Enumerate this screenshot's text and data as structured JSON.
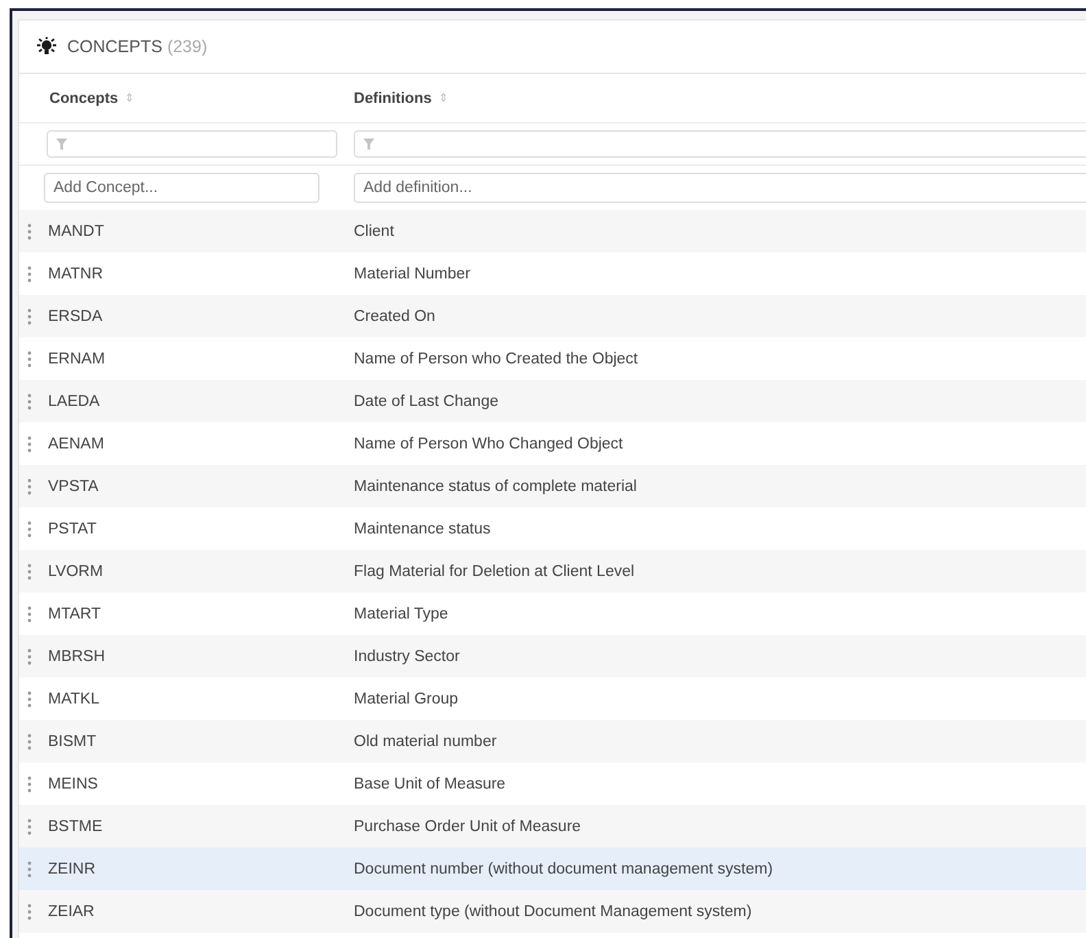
{
  "panel": {
    "title": "CONCEPTS",
    "count": "(239)"
  },
  "table": {
    "columns": [
      {
        "label": "Concepts",
        "sort_icon": "⇕"
      },
      {
        "label": "Definitions",
        "sort_icon": "⇕"
      }
    ],
    "add_row": [
      {
        "placeholder": "Add Concept..."
      },
      {
        "placeholder": "Add definition..."
      }
    ],
    "rows": [
      {
        "concept": "MANDT",
        "definition": "Client",
        "highlighted": false
      },
      {
        "concept": "MATNR",
        "definition": "Material Number",
        "highlighted": false
      },
      {
        "concept": "ERSDA",
        "definition": "Created On",
        "highlighted": false
      },
      {
        "concept": "ERNAM",
        "definition": "Name of Person who Created the Object",
        "highlighted": false
      },
      {
        "concept": "LAEDA",
        "definition": "Date of Last Change",
        "highlighted": false
      },
      {
        "concept": "AENAM",
        "definition": "Name of Person Who Changed Object",
        "highlighted": false
      },
      {
        "concept": "VPSTA",
        "definition": "Maintenance status of complete material",
        "highlighted": false
      },
      {
        "concept": "PSTAT",
        "definition": "Maintenance status",
        "highlighted": false
      },
      {
        "concept": "LVORM",
        "definition": "Flag Material for Deletion at Client Level",
        "highlighted": false
      },
      {
        "concept": "MTART",
        "definition": "Material Type",
        "highlighted": false
      },
      {
        "concept": "MBRSH",
        "definition": "Industry Sector",
        "highlighted": false
      },
      {
        "concept": "MATKL",
        "definition": "Material Group",
        "highlighted": false
      },
      {
        "concept": "BISMT",
        "definition": "Old material number",
        "highlighted": false
      },
      {
        "concept": "MEINS",
        "definition": "Base Unit of Measure",
        "highlighted": false
      },
      {
        "concept": "BSTME",
        "definition": "Purchase Order Unit of Measure",
        "highlighted": false
      },
      {
        "concept": "ZEINR",
        "definition": "Document number (without document management system)",
        "highlighted": true
      },
      {
        "concept": "ZEIAR",
        "definition": "Document type (without Document Management system)",
        "highlighted": false
      }
    ]
  }
}
